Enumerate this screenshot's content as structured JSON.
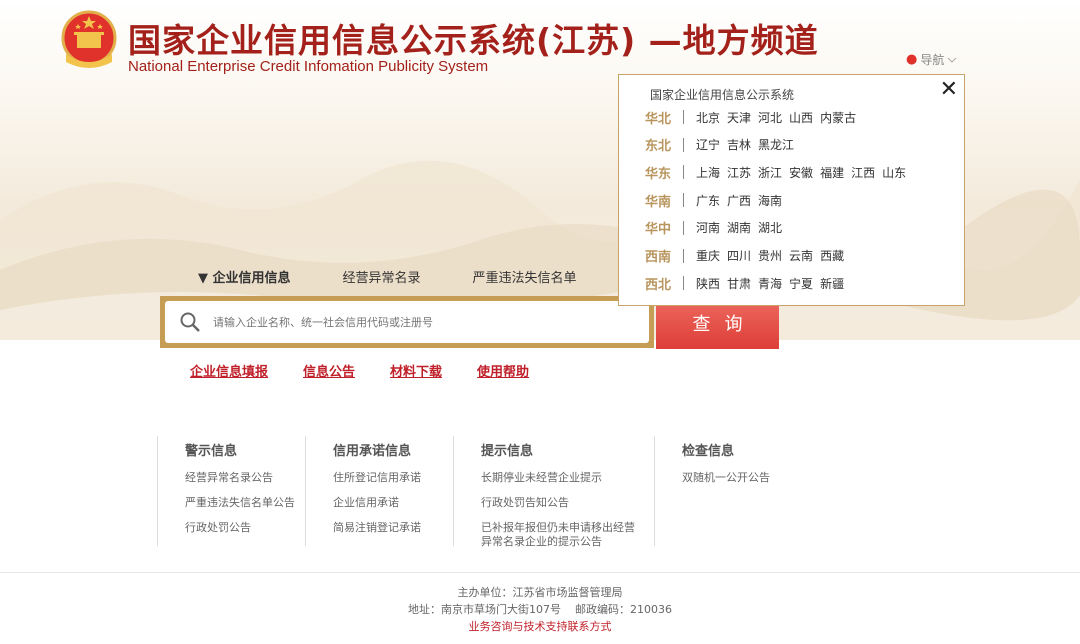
{
  "header": {
    "title_cn": "国家企业信用信息公示系统(江苏) —地方频道",
    "title_en": "National Enterprise Credit Infomation Publicity System",
    "nav_label": "导航"
  },
  "region_panel": {
    "title": "国家企业信用信息公示系统",
    "close_symbol": "✕",
    "rows": [
      {
        "region": "华北",
        "provinces": [
          "北京",
          "天津",
          "河北",
          "山西",
          "内蒙古"
        ]
      },
      {
        "region": "东北",
        "provinces": [
          "辽宁",
          "吉林",
          "黑龙江"
        ]
      },
      {
        "region": "华东",
        "provinces": [
          "上海",
          "江苏",
          "浙江",
          "安徽",
          "福建",
          "江西",
          "山东"
        ]
      },
      {
        "region": "华南",
        "provinces": [
          "广东",
          "广西",
          "海南"
        ]
      },
      {
        "region": "华中",
        "provinces": [
          "河南",
          "湖南",
          "湖北"
        ]
      },
      {
        "region": "西南",
        "provinces": [
          "重庆",
          "四川",
          "贵州",
          "云南",
          "西藏"
        ]
      },
      {
        "region": "西北",
        "provinces": [
          "陕西",
          "甘肃",
          "青海",
          "宁夏",
          "新疆"
        ]
      }
    ]
  },
  "search": {
    "tabs": [
      "▼ 企业信用信息",
      "经营异常名录",
      "严重违法失信名单"
    ],
    "placeholder": "请输入企业名称、统一社会信用代码或注册号",
    "button": "查询"
  },
  "quick_links": [
    "企业信息填报",
    "信息公告",
    "材料下载",
    "使用帮助"
  ],
  "info_columns": [
    {
      "title": "警示信息",
      "items": [
        "经营异常名录公告",
        "严重违法失信名单公告",
        "行政处罚公告"
      ]
    },
    {
      "title": "信用承诺信息",
      "items": [
        "住所登记信用承诺",
        "企业信用承诺",
        "简易注销登记承诺"
      ]
    },
    {
      "title": "提示信息",
      "items": [
        "长期停业未经营企业提示",
        "行政处罚告知公告",
        "已补报年报但仍未申请移出经营异常名录企业的提示公告"
      ]
    },
    {
      "title": "检查信息",
      "items": [
        "双随机一公开公告"
      ]
    }
  ],
  "footer": {
    "sponsor": "主办单位：江苏省市场监督管理局",
    "address": "地址：南京市草场门大街107号    邮政编码：210036",
    "contact": "业务咨询与技术支持联系方式"
  },
  "colors": {
    "brand_red": "#a3211a",
    "gold": "#c59d55",
    "link_red": "#c0202a",
    "button_red": "#e0453e"
  }
}
